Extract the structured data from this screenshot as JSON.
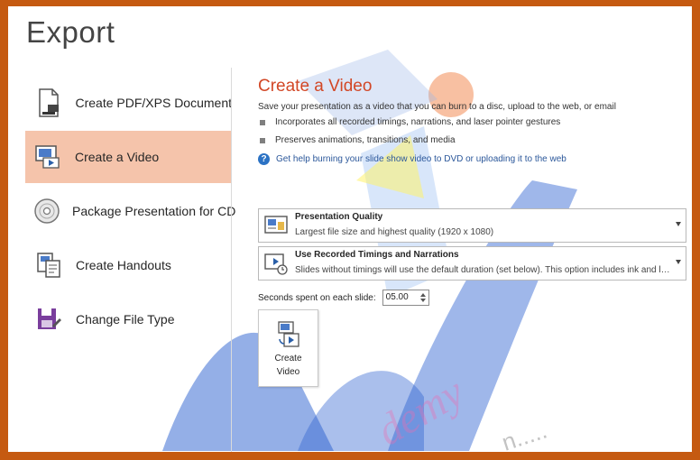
{
  "page": {
    "title": "Export"
  },
  "nav": {
    "items": [
      {
        "label": "Create PDF/XPS Document",
        "icon": "pdf-document-icon"
      },
      {
        "label": "Create a Video",
        "icon": "video-icon",
        "active": true
      },
      {
        "label": "Package Presentation for CD",
        "icon": "cd-icon"
      },
      {
        "label": "Create Handouts",
        "icon": "handouts-icon"
      },
      {
        "label": "Change File Type",
        "icon": "file-type-icon"
      }
    ]
  },
  "main": {
    "heading": "Create a Video",
    "description": "Save your presentation as a video that you can burn to a disc, upload to the web, or email",
    "bullets": [
      "Incorporates all recorded timings, narrations, and laser pointer gestures",
      "Preserves animations, transitions, and media"
    ],
    "help_link": "Get help burning your slide show video to DVD or uploading it to the web",
    "quality": {
      "title": "Presentation Quality",
      "subtitle": "Largest file size and highest quality (1920 x 1080)"
    },
    "timings": {
      "title": "Use Recorded Timings and Narrations",
      "subtitle": "Slides without timings will use the default duration (set below). This option includes ink and las..."
    },
    "seconds": {
      "label": "Seconds spent on each slide:",
      "value": "05.00"
    },
    "create_button": {
      "line1": "Create",
      "line2": "Video"
    }
  },
  "colors": {
    "border": "#c55a11",
    "accent": "#d24726",
    "active_nav": "#f5c4ab",
    "link": "#2b579a"
  }
}
